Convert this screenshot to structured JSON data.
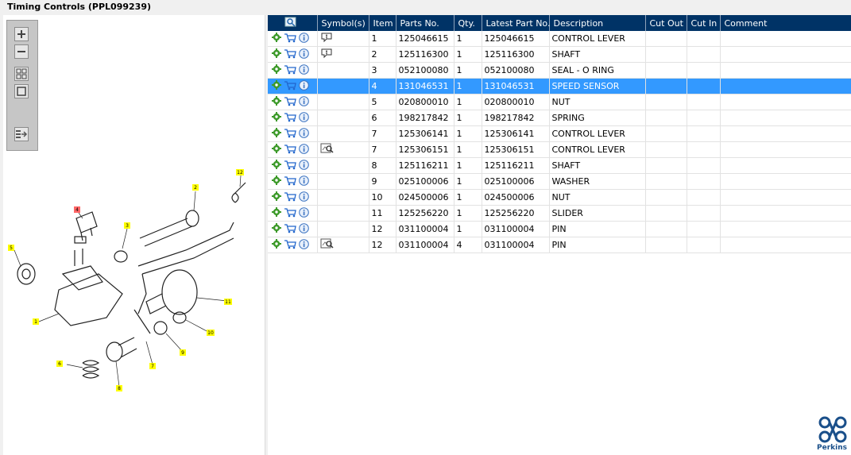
{
  "window": {
    "title": "Timing Controls (PPL099239)"
  },
  "toolbar": {
    "icons": [
      "zoom-in-icon",
      "zoom-out-icon",
      "fit-view-icon",
      "actual-size-icon",
      "export-icon"
    ]
  },
  "diagram": {
    "callouts": [
      "1",
      "2",
      "3",
      "4",
      "5",
      "6",
      "7",
      "8",
      "9",
      "10",
      "11",
      "12"
    ]
  },
  "table": {
    "columns": [
      "",
      "Symbol(s)",
      "Item",
      "Parts No.",
      "Qty.",
      "Latest Part No.",
      "Description",
      "Cut Out",
      "Cut In",
      "Comment"
    ],
    "rows": [
      {
        "symbol": "note",
        "item": "1",
        "part": "125046615",
        "qty": "1",
        "latest": "125046615",
        "desc": "CONTROL LEVER",
        "cutout": "",
        "cutin": "",
        "comment": ""
      },
      {
        "symbol": "note",
        "item": "2",
        "part": "125116300",
        "qty": "1",
        "latest": "125116300",
        "desc": "SHAFT",
        "cutout": "",
        "cutin": "",
        "comment": ""
      },
      {
        "symbol": "",
        "item": "3",
        "part": "052100080",
        "qty": "1",
        "latest": "052100080",
        "desc": "SEAL - O RING",
        "cutout": "",
        "cutin": "",
        "comment": ""
      },
      {
        "symbol": "",
        "item": "4",
        "part": "131046531",
        "qty": "1",
        "latest": "131046531",
        "desc": "SPEED SENSOR",
        "cutout": "",
        "cutin": "",
        "comment": "",
        "selected": true
      },
      {
        "symbol": "",
        "item": "5",
        "part": "020800010",
        "qty": "1",
        "latest": "020800010",
        "desc": "NUT",
        "cutout": "",
        "cutin": "",
        "comment": ""
      },
      {
        "symbol": "",
        "item": "6",
        "part": "198217842",
        "qty": "1",
        "latest": "198217842",
        "desc": "SPRING",
        "cutout": "",
        "cutin": "",
        "comment": ""
      },
      {
        "symbol": "",
        "item": "7",
        "part": "125306141",
        "qty": "1",
        "latest": "125306141",
        "desc": "CONTROL LEVER",
        "cutout": "",
        "cutin": "",
        "comment": ""
      },
      {
        "symbol": "zoom",
        "item": "7",
        "part": "125306151",
        "qty": "1",
        "latest": "125306151",
        "desc": "CONTROL LEVER",
        "cutout": "",
        "cutin": "",
        "comment": ""
      },
      {
        "symbol": "",
        "item": "8",
        "part": "125116211",
        "qty": "1",
        "latest": "125116211",
        "desc": "SHAFT",
        "cutout": "",
        "cutin": "",
        "comment": ""
      },
      {
        "symbol": "",
        "item": "9",
        "part": "025100006",
        "qty": "1",
        "latest": "025100006",
        "desc": "WASHER",
        "cutout": "",
        "cutin": "",
        "comment": ""
      },
      {
        "symbol": "",
        "item": "10",
        "part": "024500006",
        "qty": "1",
        "latest": "024500006",
        "desc": "NUT",
        "cutout": "",
        "cutin": "",
        "comment": ""
      },
      {
        "symbol": "",
        "item": "11",
        "part": "125256220",
        "qty": "1",
        "latest": "125256220",
        "desc": "SLIDER",
        "cutout": "",
        "cutin": "",
        "comment": ""
      },
      {
        "symbol": "",
        "item": "12",
        "part": "031100004",
        "qty": "1",
        "latest": "031100004",
        "desc": "PIN",
        "cutout": "",
        "cutin": "",
        "comment": ""
      },
      {
        "symbol": "zoom",
        "item": "12",
        "part": "031100004",
        "qty": "4",
        "latest": "031100004",
        "desc": "PIN",
        "cutout": "",
        "cutin": "",
        "comment": ""
      }
    ]
  },
  "brand": {
    "name": "Perkins",
    "color": "#1a4f8a"
  },
  "colors": {
    "header": "#003366",
    "selected": "#3399ff",
    "callout": "#ffff00",
    "callout_active": "#ff6666"
  }
}
